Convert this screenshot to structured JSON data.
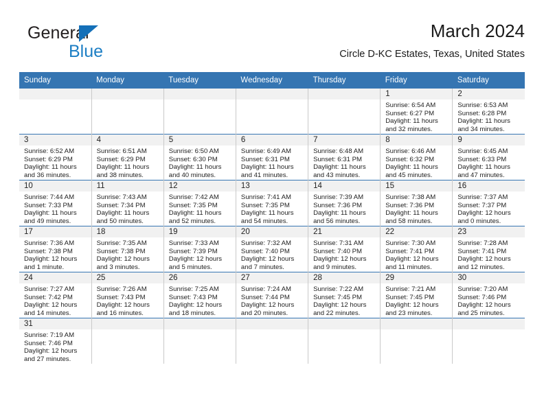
{
  "brand": {
    "name_top": "General",
    "name_bottom": "Blue",
    "triangle_color": "#1470b8",
    "blue_color": "#1c7ec4"
  },
  "header": {
    "title": "March 2024",
    "subtitle": "Circle D-KC Estates, Texas, United States"
  },
  "theme": {
    "header_blue": "#3575b2",
    "daynum_band": "#f1f1f1",
    "text": "#222222"
  },
  "weekday_headers": [
    "Sunday",
    "Monday",
    "Tuesday",
    "Wednesday",
    "Thursday",
    "Friday",
    "Saturday"
  ],
  "weeks": [
    [
      {
        "day": "",
        "sunrise": "",
        "sunset": "",
        "daylight_line1": "",
        "daylight_line2": ""
      },
      {
        "day": "",
        "sunrise": "",
        "sunset": "",
        "daylight_line1": "",
        "daylight_line2": ""
      },
      {
        "day": "",
        "sunrise": "",
        "sunset": "",
        "daylight_line1": "",
        "daylight_line2": ""
      },
      {
        "day": "",
        "sunrise": "",
        "sunset": "",
        "daylight_line1": "",
        "daylight_line2": ""
      },
      {
        "day": "",
        "sunrise": "",
        "sunset": "",
        "daylight_line1": "",
        "daylight_line2": ""
      },
      {
        "day": "1",
        "sunrise": "Sunrise: 6:54 AM",
        "sunset": "Sunset: 6:27 PM",
        "daylight_line1": "Daylight: 11 hours",
        "daylight_line2": "and 32 minutes."
      },
      {
        "day": "2",
        "sunrise": "Sunrise: 6:53 AM",
        "sunset": "Sunset: 6:28 PM",
        "daylight_line1": "Daylight: 11 hours",
        "daylight_line2": "and 34 minutes."
      }
    ],
    [
      {
        "day": "3",
        "sunrise": "Sunrise: 6:52 AM",
        "sunset": "Sunset: 6:29 PM",
        "daylight_line1": "Daylight: 11 hours",
        "daylight_line2": "and 36 minutes."
      },
      {
        "day": "4",
        "sunrise": "Sunrise: 6:51 AM",
        "sunset": "Sunset: 6:29 PM",
        "daylight_line1": "Daylight: 11 hours",
        "daylight_line2": "and 38 minutes."
      },
      {
        "day": "5",
        "sunrise": "Sunrise: 6:50 AM",
        "sunset": "Sunset: 6:30 PM",
        "daylight_line1": "Daylight: 11 hours",
        "daylight_line2": "and 40 minutes."
      },
      {
        "day": "6",
        "sunrise": "Sunrise: 6:49 AM",
        "sunset": "Sunset: 6:31 PM",
        "daylight_line1": "Daylight: 11 hours",
        "daylight_line2": "and 41 minutes."
      },
      {
        "day": "7",
        "sunrise": "Sunrise: 6:48 AM",
        "sunset": "Sunset: 6:31 PM",
        "daylight_line1": "Daylight: 11 hours",
        "daylight_line2": "and 43 minutes."
      },
      {
        "day": "8",
        "sunrise": "Sunrise: 6:46 AM",
        "sunset": "Sunset: 6:32 PM",
        "daylight_line1": "Daylight: 11 hours",
        "daylight_line2": "and 45 minutes."
      },
      {
        "day": "9",
        "sunrise": "Sunrise: 6:45 AM",
        "sunset": "Sunset: 6:33 PM",
        "daylight_line1": "Daylight: 11 hours",
        "daylight_line2": "and 47 minutes."
      }
    ],
    [
      {
        "day": "10",
        "sunrise": "Sunrise: 7:44 AM",
        "sunset": "Sunset: 7:33 PM",
        "daylight_line1": "Daylight: 11 hours",
        "daylight_line2": "and 49 minutes."
      },
      {
        "day": "11",
        "sunrise": "Sunrise: 7:43 AM",
        "sunset": "Sunset: 7:34 PM",
        "daylight_line1": "Daylight: 11 hours",
        "daylight_line2": "and 50 minutes."
      },
      {
        "day": "12",
        "sunrise": "Sunrise: 7:42 AM",
        "sunset": "Sunset: 7:35 PM",
        "daylight_line1": "Daylight: 11 hours",
        "daylight_line2": "and 52 minutes."
      },
      {
        "day": "13",
        "sunrise": "Sunrise: 7:41 AM",
        "sunset": "Sunset: 7:35 PM",
        "daylight_line1": "Daylight: 11 hours",
        "daylight_line2": "and 54 minutes."
      },
      {
        "day": "14",
        "sunrise": "Sunrise: 7:39 AM",
        "sunset": "Sunset: 7:36 PM",
        "daylight_line1": "Daylight: 11 hours",
        "daylight_line2": "and 56 minutes."
      },
      {
        "day": "15",
        "sunrise": "Sunrise: 7:38 AM",
        "sunset": "Sunset: 7:36 PM",
        "daylight_line1": "Daylight: 11 hours",
        "daylight_line2": "and 58 minutes."
      },
      {
        "day": "16",
        "sunrise": "Sunrise: 7:37 AM",
        "sunset": "Sunset: 7:37 PM",
        "daylight_line1": "Daylight: 12 hours",
        "daylight_line2": "and 0 minutes."
      }
    ],
    [
      {
        "day": "17",
        "sunrise": "Sunrise: 7:36 AM",
        "sunset": "Sunset: 7:38 PM",
        "daylight_line1": "Daylight: 12 hours",
        "daylight_line2": "and 1 minute."
      },
      {
        "day": "18",
        "sunrise": "Sunrise: 7:35 AM",
        "sunset": "Sunset: 7:38 PM",
        "daylight_line1": "Daylight: 12 hours",
        "daylight_line2": "and 3 minutes."
      },
      {
        "day": "19",
        "sunrise": "Sunrise: 7:33 AM",
        "sunset": "Sunset: 7:39 PM",
        "daylight_line1": "Daylight: 12 hours",
        "daylight_line2": "and 5 minutes."
      },
      {
        "day": "20",
        "sunrise": "Sunrise: 7:32 AM",
        "sunset": "Sunset: 7:40 PM",
        "daylight_line1": "Daylight: 12 hours",
        "daylight_line2": "and 7 minutes."
      },
      {
        "day": "21",
        "sunrise": "Sunrise: 7:31 AM",
        "sunset": "Sunset: 7:40 PM",
        "daylight_line1": "Daylight: 12 hours",
        "daylight_line2": "and 9 minutes."
      },
      {
        "day": "22",
        "sunrise": "Sunrise: 7:30 AM",
        "sunset": "Sunset: 7:41 PM",
        "daylight_line1": "Daylight: 12 hours",
        "daylight_line2": "and 11 minutes."
      },
      {
        "day": "23",
        "sunrise": "Sunrise: 7:28 AM",
        "sunset": "Sunset: 7:41 PM",
        "daylight_line1": "Daylight: 12 hours",
        "daylight_line2": "and 12 minutes."
      }
    ],
    [
      {
        "day": "24",
        "sunrise": "Sunrise: 7:27 AM",
        "sunset": "Sunset: 7:42 PM",
        "daylight_line1": "Daylight: 12 hours",
        "daylight_line2": "and 14 minutes."
      },
      {
        "day": "25",
        "sunrise": "Sunrise: 7:26 AM",
        "sunset": "Sunset: 7:43 PM",
        "daylight_line1": "Daylight: 12 hours",
        "daylight_line2": "and 16 minutes."
      },
      {
        "day": "26",
        "sunrise": "Sunrise: 7:25 AM",
        "sunset": "Sunset: 7:43 PM",
        "daylight_line1": "Daylight: 12 hours",
        "daylight_line2": "and 18 minutes."
      },
      {
        "day": "27",
        "sunrise": "Sunrise: 7:24 AM",
        "sunset": "Sunset: 7:44 PM",
        "daylight_line1": "Daylight: 12 hours",
        "daylight_line2": "and 20 minutes."
      },
      {
        "day": "28",
        "sunrise": "Sunrise: 7:22 AM",
        "sunset": "Sunset: 7:45 PM",
        "daylight_line1": "Daylight: 12 hours",
        "daylight_line2": "and 22 minutes."
      },
      {
        "day": "29",
        "sunrise": "Sunrise: 7:21 AM",
        "sunset": "Sunset: 7:45 PM",
        "daylight_line1": "Daylight: 12 hours",
        "daylight_line2": "and 23 minutes."
      },
      {
        "day": "30",
        "sunrise": "Sunrise: 7:20 AM",
        "sunset": "Sunset: 7:46 PM",
        "daylight_line1": "Daylight: 12 hours",
        "daylight_line2": "and 25 minutes."
      }
    ],
    [
      {
        "day": "31",
        "sunrise": "Sunrise: 7:19 AM",
        "sunset": "Sunset: 7:46 PM",
        "daylight_line1": "Daylight: 12 hours",
        "daylight_line2": "and 27 minutes."
      },
      {
        "day": "",
        "sunrise": "",
        "sunset": "",
        "daylight_line1": "",
        "daylight_line2": ""
      },
      {
        "day": "",
        "sunrise": "",
        "sunset": "",
        "daylight_line1": "",
        "daylight_line2": ""
      },
      {
        "day": "",
        "sunrise": "",
        "sunset": "",
        "daylight_line1": "",
        "daylight_line2": ""
      },
      {
        "day": "",
        "sunrise": "",
        "sunset": "",
        "daylight_line1": "",
        "daylight_line2": ""
      },
      {
        "day": "",
        "sunrise": "",
        "sunset": "",
        "daylight_line1": "",
        "daylight_line2": ""
      },
      {
        "day": "",
        "sunrise": "",
        "sunset": "",
        "daylight_line1": "",
        "daylight_line2": ""
      }
    ]
  ]
}
